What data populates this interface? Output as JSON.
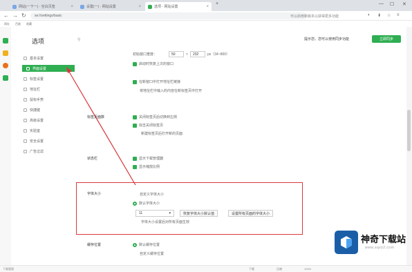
{
  "browser": {
    "tabs": [
      {
        "label": "网站(一下一) - 空白页签"
      },
      {
        "label": "设置(一) - 网站设置"
      },
      {
        "label": "选项 - 网站设置"
      }
    ],
    "address": "se://settings/basic",
    "addr_right": "可以启用新版本以获得更多功能",
    "bookmark_items": [
      "网址",
      "百度",
      "收藏"
    ]
  },
  "sidebar": {
    "title": "选项",
    "items": [
      {
        "label": "基本设置"
      },
      {
        "label": "界面设置"
      },
      {
        "label": "标签设置"
      },
      {
        "label": "地址栏"
      },
      {
        "label": "鼠标手势"
      },
      {
        "label": "快捷键"
      },
      {
        "label": "高级设置"
      },
      {
        "label": "实验室"
      },
      {
        "label": "安全设置"
      },
      {
        "label": "广告过滤"
      }
    ]
  },
  "banner": {
    "text": "提示您，您可以使用同步功能",
    "button": "立即同步"
  },
  "main": {
    "winsize_label": "初始窗口宽度：",
    "winsize_w": "50",
    "winsize_h": "232",
    "winsize_hint": "px（34~800）",
    "opt_mem": "启动时恢复上次的窗口",
    "opt_a1": "在新窗口中打开地址栏链接",
    "opt_a2": "将地址栏中输入的内容在新标签页中打开",
    "sect_tab": "标签页面数",
    "opt_t1": "关闭标签页后切换到左侧",
    "opt_t2": "双击关闭标签页",
    "opt_t3": "新建标签页后打开新的页面",
    "sect_bar": "状态栏",
    "opt_b1": "显示下载管理器",
    "opt_b2": "显示缩放比例",
    "sect_font": "字体大小",
    "font_hint": "自定义字体大小",
    "font_radio": "默认字体大小",
    "font_size": "11",
    "font_btn1": "恢复字体大小默认值",
    "font_btn2": "设置所有页面的字体大小",
    "font_note": "字体大小设置后对所有页面生效",
    "sect_cache": "缓存位置",
    "cache_opt1": "默认缓存位置",
    "cache_opt2": "自定义缓存位置"
  },
  "statusbar": {
    "left": "下载管理",
    "items": [
      "下载",
      "压缩",
      "100%"
    ]
  },
  "watermark": {
    "title": "神奇下载站",
    "url": "www.sqxz2.com"
  }
}
